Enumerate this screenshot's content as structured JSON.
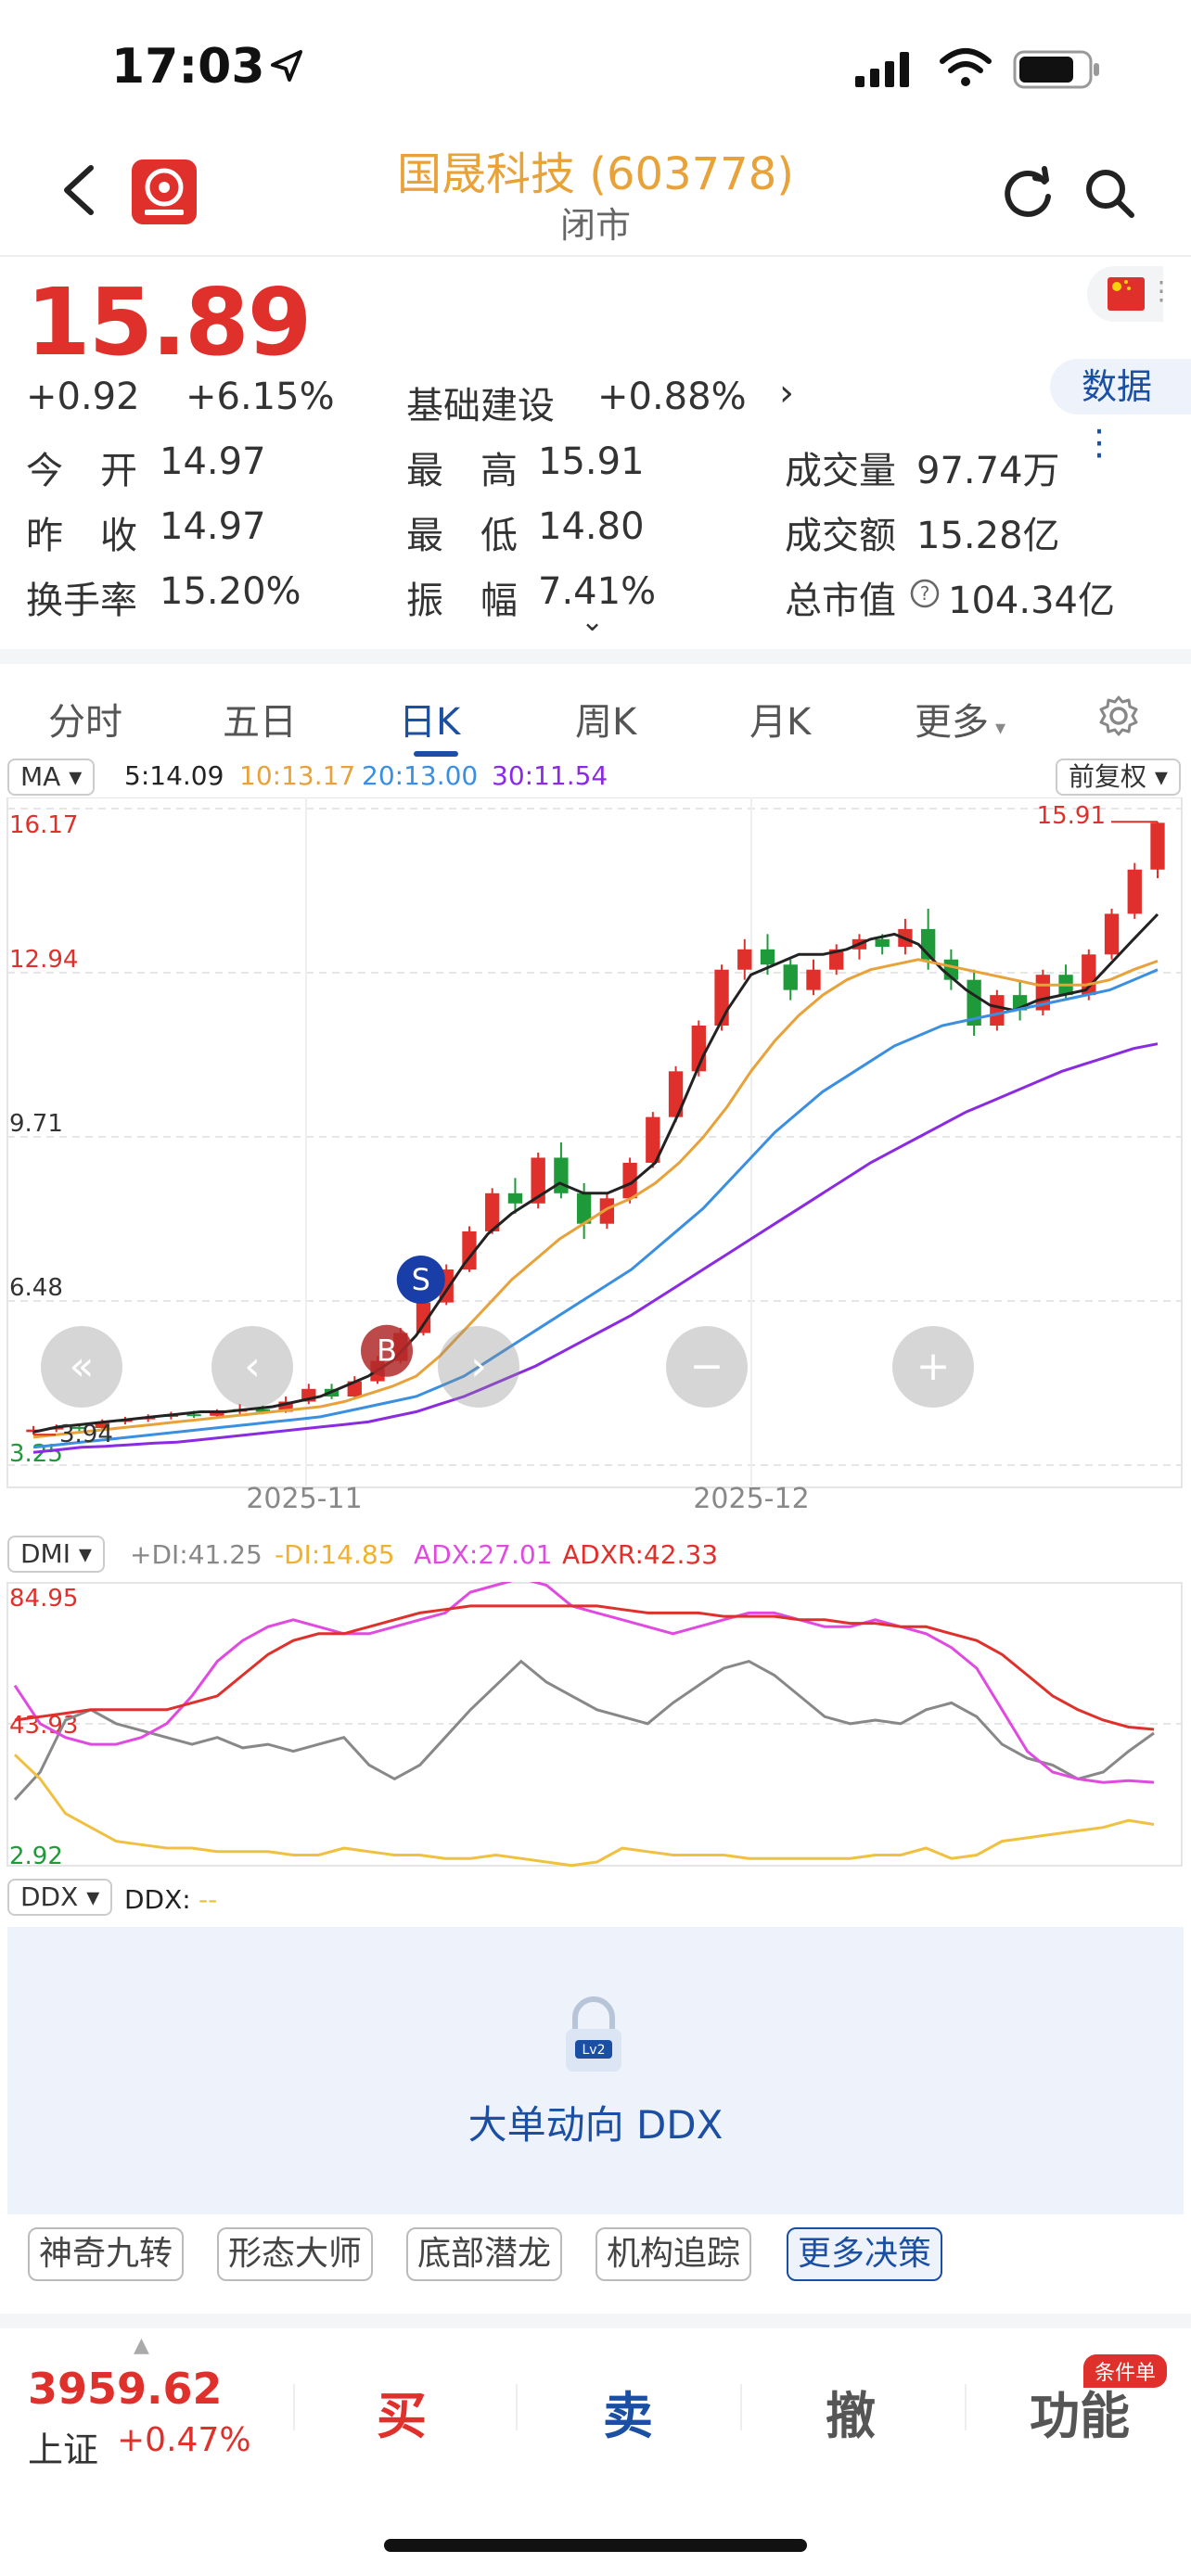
{
  "status_bar": {
    "time": "17:03"
  },
  "header": {
    "title": "国晟科技 (603778)",
    "subtitle": "闭市"
  },
  "quote": {
    "price": "15.89",
    "change": "+0.92",
    "change_pct": "+6.15%",
    "sector": "基础建设",
    "sector_pct": "+0.88%",
    "data_button": "数据",
    "open_label": "今　开",
    "open_value": "14.97",
    "prev_close_label": "昨　收",
    "prev_close_value": "14.97",
    "turnover_label": "换手率",
    "turnover_value": "15.20%",
    "high_label": "最　高",
    "high_value": "15.91",
    "low_label": "最　低",
    "low_value": "14.80",
    "amplitude_label": "振　幅",
    "amplitude_value": "7.41%",
    "volume_label": "成交量",
    "volume_value": "97.74万",
    "amount_label": "成交额",
    "amount_value": "15.28亿",
    "mktcap_label": "总市值",
    "mktcap_value": "104.34亿"
  },
  "tabs": [
    {
      "label": "分时"
    },
    {
      "label": "五日"
    },
    {
      "label": "日K"
    },
    {
      "label": "周K"
    },
    {
      "label": "月K"
    },
    {
      "label": "更多"
    }
  ],
  "main_chart": {
    "indicator_select": "MA",
    "adjust_select": "前复权",
    "ma5": "5:14.09",
    "ma10": "10:13.17",
    "ma20": "20:13.00",
    "ma30": "30:11.54",
    "y_ticks": [
      "16.17",
      "12.94",
      "9.71",
      "6.48",
      "3.25"
    ],
    "x_ticks": [
      "2025-11",
      "2025-12"
    ],
    "max_label": "15.91",
    "min_label": "3.94",
    "sell_marker": "S",
    "buy_marker": "B"
  },
  "dmi_chart": {
    "indicator_select": "DMI",
    "pdi": "+DI:41.25",
    "mdi": "-DI:14.85",
    "adx": "ADX:27.01",
    "adxr": "ADXR:42.33",
    "y_ticks": [
      "84.95",
      "43.93",
      "2.92"
    ]
  },
  "ddx": {
    "indicator_select": "DDX",
    "label": "DDX:",
    "value": "--",
    "lock_badge": "Lv2",
    "panel_text": "大单动向 DDX"
  },
  "strategies": [
    {
      "label": "神奇九转"
    },
    {
      "label": "形态大师"
    },
    {
      "label": "底部潜龙"
    },
    {
      "label": "机构追踪"
    },
    {
      "label": "更多决策"
    }
  ],
  "bottom_bar": {
    "index_value": "3959.62",
    "index_name": "上证",
    "index_pct": "+0.47%",
    "buy": "买",
    "sell": "卖",
    "cancel": "撤",
    "func": "功能",
    "func_badge": "条件单"
  },
  "colors": {
    "up": "#e0302b",
    "down": "#1f9a3a",
    "accent": "#1a4fa3",
    "title": "#e8a23a",
    "ma5": "#222222",
    "ma10": "#e8a23a",
    "ma20": "#3b8fe0",
    "ma30": "#8a2be2",
    "pdi": "#888888",
    "mdi": "#f0c040",
    "adx": "#e04ae0",
    "adxr": "#e0302b"
  },
  "chart_data": [
    {
      "type": "line",
      "title": "",
      "ylim": [
        3.25,
        16.17
      ],
      "x_ticks": [
        "2025-11",
        "2025-12"
      ],
      "series": [
        {
          "name": "5",
          "values": [
            3.9,
            4.0,
            4.05,
            4.1,
            4.15,
            4.2,
            4.25,
            4.3,
            4.3,
            4.35,
            4.4,
            4.5,
            4.6,
            4.8,
            5.0,
            5.3,
            5.8,
            6.5,
            7.2,
            7.8,
            8.2,
            8.5,
            8.8,
            8.6,
            8.6,
            8.8,
            9.2,
            10.2,
            11.3,
            12.2,
            12.9,
            13.1,
            13.3,
            13.3,
            13.4,
            13.6,
            13.7,
            13.5,
            13.0,
            12.6,
            12.3,
            12.2,
            12.4,
            12.5,
            12.6,
            13.1,
            13.6,
            14.09
          ]
        },
        {
          "name": "10",
          "values": [
            3.8,
            3.85,
            3.9,
            3.95,
            4.0,
            4.05,
            4.1,
            4.15,
            4.2,
            4.25,
            4.3,
            4.35,
            4.4,
            4.5,
            4.65,
            4.8,
            5.0,
            5.4,
            5.9,
            6.4,
            6.9,
            7.3,
            7.7,
            8.0,
            8.3,
            8.5,
            8.8,
            9.2,
            9.7,
            10.3,
            11.0,
            11.6,
            12.1,
            12.5,
            12.8,
            13.0,
            13.1,
            13.2,
            13.1,
            13.0,
            12.9,
            12.8,
            12.7,
            12.7,
            12.7,
            12.8,
            13.0,
            13.17
          ]
        },
        {
          "name": "20",
          "values": [
            3.6,
            3.65,
            3.7,
            3.75,
            3.8,
            3.85,
            3.9,
            3.95,
            4.0,
            4.05,
            4.1,
            4.15,
            4.2,
            4.3,
            4.4,
            4.5,
            4.6,
            4.8,
            5.0,
            5.3,
            5.6,
            5.9,
            6.2,
            6.5,
            6.8,
            7.1,
            7.5,
            7.9,
            8.3,
            8.8,
            9.3,
            9.8,
            10.2,
            10.6,
            10.9,
            11.2,
            11.5,
            11.7,
            11.9,
            12.0,
            12.1,
            12.2,
            12.3,
            12.4,
            12.5,
            12.6,
            12.8,
            13.0
          ]
        },
        {
          "name": "30",
          "values": [
            3.5,
            3.55,
            3.6,
            3.62,
            3.65,
            3.68,
            3.7,
            3.75,
            3.8,
            3.85,
            3.9,
            3.95,
            4.0,
            4.05,
            4.1,
            4.2,
            4.3,
            4.45,
            4.6,
            4.8,
            5.0,
            5.2,
            5.45,
            5.7,
            5.95,
            6.2,
            6.5,
            6.8,
            7.1,
            7.4,
            7.7,
            8.0,
            8.3,
            8.6,
            8.9,
            9.2,
            9.45,
            9.7,
            9.95,
            10.2,
            10.4,
            10.6,
            10.8,
            11.0,
            11.15,
            11.3,
            11.45,
            11.54
          ]
        }
      ],
      "candles": [
        [
          3.9,
          3.95,
          4.02,
          3.85
        ],
        [
          3.95,
          4.0,
          4.05,
          3.9
        ],
        [
          4.0,
          3.98,
          4.06,
          3.92
        ],
        [
          3.98,
          4.1,
          4.15,
          3.95
        ],
        [
          4.1,
          4.15,
          4.2,
          4.05
        ],
        [
          4.15,
          4.2,
          4.25,
          4.1
        ],
        [
          4.2,
          4.25,
          4.3,
          4.15
        ],
        [
          4.25,
          4.22,
          4.32,
          4.18
        ],
        [
          4.22,
          4.3,
          4.35,
          4.18
        ],
        [
          4.3,
          4.35,
          4.45,
          4.25
        ],
        [
          4.35,
          4.3,
          4.42,
          4.25
        ],
        [
          4.3,
          4.5,
          4.6,
          4.28
        ],
        [
          4.5,
          4.75,
          4.85,
          4.45
        ],
        [
          4.75,
          4.6,
          4.85,
          4.55
        ],
        [
          4.6,
          4.9,
          5.0,
          4.55
        ],
        [
          4.9,
          5.3,
          5.4,
          4.85
        ],
        [
          5.3,
          5.85,
          5.95,
          5.25
        ],
        [
          5.85,
          6.45,
          6.55,
          5.8
        ],
        [
          6.45,
          7.1,
          7.2,
          6.4
        ],
        [
          7.1,
          7.85,
          7.95,
          7.05
        ],
        [
          7.85,
          8.6,
          8.7,
          7.8
        ],
        [
          8.6,
          8.4,
          8.9,
          8.2
        ],
        [
          8.4,
          9.3,
          9.4,
          8.3
        ],
        [
          9.3,
          8.6,
          9.6,
          8.5
        ],
        [
          8.6,
          8.0,
          8.8,
          7.7
        ],
        [
          8.0,
          8.5,
          8.6,
          7.9
        ],
        [
          8.5,
          9.2,
          9.3,
          8.4
        ],
        [
          9.2,
          10.1,
          10.2,
          9.1
        ],
        [
          10.1,
          11.0,
          11.1,
          10.0
        ],
        [
          11.0,
          11.9,
          12.0,
          10.9
        ],
        [
          11.9,
          13.0,
          13.1,
          11.8
        ],
        [
          13.0,
          13.4,
          13.6,
          12.8
        ],
        [
          13.4,
          13.1,
          13.7,
          12.9
        ],
        [
          13.1,
          12.6,
          13.2,
          12.4
        ],
        [
          12.6,
          13.0,
          13.2,
          12.5
        ],
        [
          13.0,
          13.4,
          13.5,
          12.9
        ],
        [
          13.4,
          13.6,
          13.7,
          13.2
        ],
        [
          13.6,
          13.45,
          13.7,
          13.3
        ],
        [
          13.45,
          13.8,
          14.0,
          13.3
        ],
        [
          13.8,
          13.2,
          14.2,
          13.0
        ],
        [
          13.2,
          12.8,
          13.4,
          12.6
        ],
        [
          12.8,
          11.9,
          13.0,
          11.7
        ],
        [
          11.9,
          12.5,
          12.6,
          11.8
        ],
        [
          12.5,
          12.2,
          12.8,
          12.0
        ],
        [
          12.2,
          12.9,
          13.0,
          12.1
        ],
        [
          12.9,
          12.5,
          13.1,
          12.4
        ],
        [
          12.5,
          13.3,
          13.4,
          12.4
        ],
        [
          13.3,
          14.1,
          14.2,
          13.2
        ],
        [
          14.1,
          14.97,
          15.1,
          14.0
        ],
        [
          14.97,
          15.89,
          15.91,
          14.8
        ]
      ]
    },
    {
      "type": "line",
      "title": "",
      "ylim": [
        2.92,
        84.95
      ],
      "series": [
        {
          "name": "+DI",
          "values": [
            22,
            30,
            45,
            48,
            44,
            42,
            40,
            38,
            40,
            37,
            38,
            36,
            38,
            40,
            32,
            28,
            32,
            40,
            48,
            55,
            62,
            56,
            52,
            48,
            46,
            44,
            50,
            55,
            60,
            62,
            58,
            52,
            46,
            44,
            45,
            44,
            48,
            50,
            46,
            38,
            34,
            32,
            28,
            30,
            36,
            41.25
          ]
        },
        {
          "name": "-DI",
          "values": [
            35,
            28,
            18,
            14,
            10,
            9,
            8,
            8,
            7,
            7,
            7,
            6,
            6,
            8,
            7,
            6,
            6,
            5,
            5,
            6,
            5,
            4,
            3,
            4,
            8,
            7,
            6,
            6,
            6,
            5,
            5,
            5,
            5,
            5,
            6,
            6,
            8,
            5,
            6,
            10,
            11,
            12,
            13,
            14,
            16,
            14.85
          ]
        },
        {
          "name": "ADX",
          "values": [
            55,
            44,
            40,
            38,
            38,
            40,
            44,
            52,
            62,
            68,
            72,
            74,
            72,
            70,
            70,
            72,
            74,
            76,
            82,
            84,
            86,
            84,
            78,
            76,
            74,
            72,
            70,
            72,
            74,
            76,
            76,
            74,
            72,
            72,
            74,
            72,
            70,
            66,
            60,
            48,
            36,
            30,
            28,
            27,
            27.5,
            27.01
          ]
        },
        {
          "name": "ADXR",
          "values": [
            45,
            46,
            47,
            48,
            48,
            48,
            48,
            50,
            52,
            58,
            64,
            68,
            70,
            70,
            72,
            74,
            76,
            77,
            78,
            78,
            78,
            78,
            78,
            78,
            77,
            76,
            76,
            76,
            75,
            75,
            75,
            74,
            74,
            73,
            73,
            72,
            72,
            70,
            68,
            64,
            58,
            52,
            48,
            45,
            43,
            42.33
          ]
        }
      ]
    }
  ]
}
